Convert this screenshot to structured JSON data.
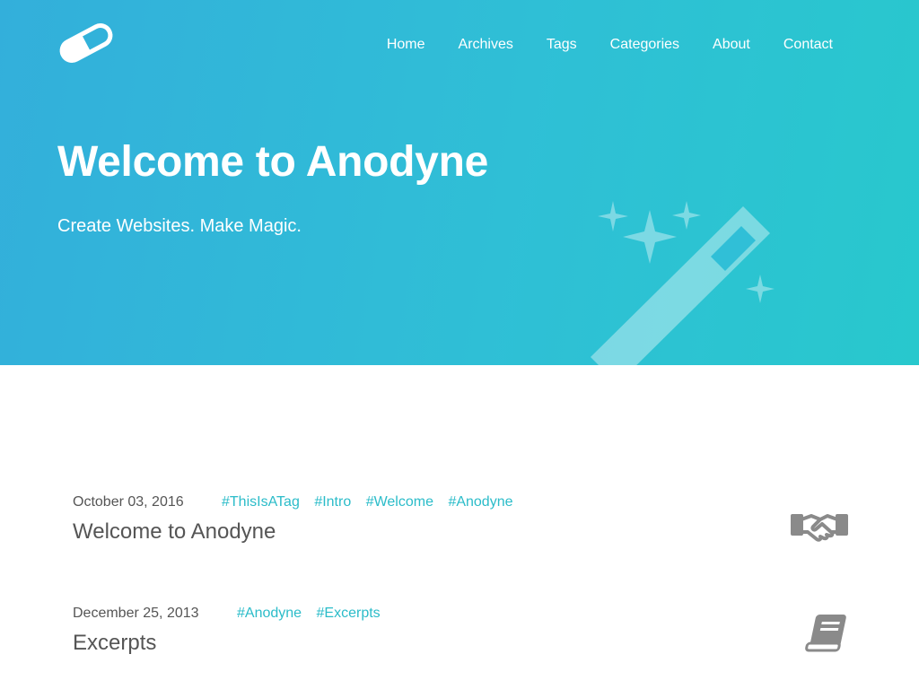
{
  "brand": {
    "logo_icon": "pill-icon",
    "accent": "#2bbcc9",
    "gradient_start": "#33afdb",
    "gradient_end": "#28c8cd"
  },
  "nav": {
    "items": [
      {
        "label": "Home"
      },
      {
        "label": "Archives"
      },
      {
        "label": "Tags"
      },
      {
        "label": "Categories"
      },
      {
        "label": "About"
      },
      {
        "label": "Contact"
      }
    ]
  },
  "hero": {
    "title": "Welcome to Anodyne",
    "subtitle": "Create Websites. Make Magic.",
    "illustration": "magic-wand-icon"
  },
  "posts": [
    {
      "date": "October 03, 2016",
      "tags": [
        "#ThisIsATag",
        "#Intro",
        "#Welcome",
        "#Anodyne"
      ],
      "title": "Welcome to Anodyne",
      "icon": "handshake-icon"
    },
    {
      "date": "December 25, 2013",
      "tags": [
        "#Anodyne",
        "#Excerpts"
      ],
      "title": "Excerpts",
      "icon": "book-icon"
    }
  ]
}
